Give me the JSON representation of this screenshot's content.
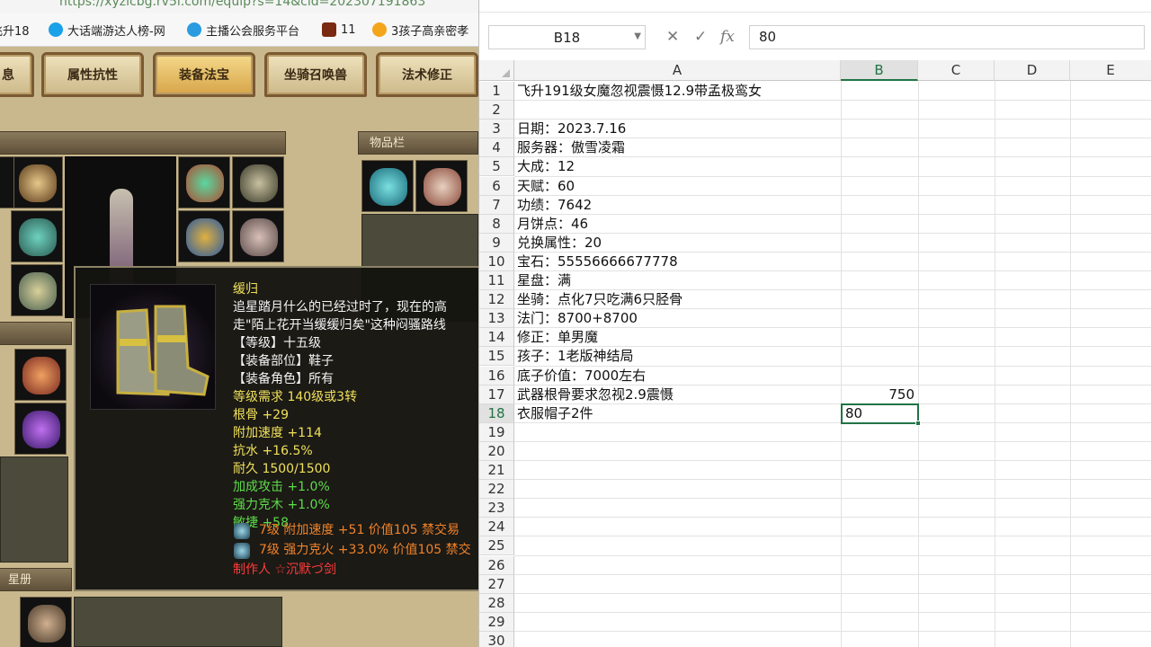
{
  "browser": {
    "url_fragment": "https://xyzlcbg.rv5i.com/equip?s=14&cid=202307191863",
    "bookmarks": [
      {
        "label": "飞升18",
        "color": "#2e6fd9"
      },
      {
        "label": "大话端游达人榜-网",
        "color": "#1aa1e8"
      },
      {
        "label": "主播公会服务平台",
        "color": "#2a9be0"
      },
      {
        "label": "11",
        "color": "#7a2a10"
      },
      {
        "label": "3孩子高亲密孝",
        "color": "#f3a51c"
      }
    ]
  },
  "game": {
    "tabs": [
      "息",
      "属性抗性",
      "装备法宝",
      "坐骑召唤兽",
      "法术修正"
    ],
    "active_tab": "装备法宝",
    "inventory_title": "物品栏",
    "starbook_title": "星册",
    "tooltip": {
      "name": "缓归",
      "desc1": "追星踏月什么的已经过时了，现在的高",
      "desc2": "走\"陌上花开当缓缓归矣\"这种闷骚路线",
      "level": "【等级】十五级",
      "slot": "【装备部位】鞋子",
      "role": "【装备角色】所有",
      "req": "等级需求 140级或3转",
      "stat1": "根骨 +29",
      "stat2": "附加速度 +114",
      "stat3": "抗水 +16.5%",
      "durability": "耐久 1500/1500",
      "bonus1": "加成攻击 +1.0%",
      "bonus2": "强力克木 +1.0%",
      "bonus3": "敏捷 +58",
      "gem1": "7级 附加速度 +51 价值105 禁交易",
      "gem2": "7级 强力克火 +33.0% 价值105 禁交",
      "maker": "制作人 ☆沉默づ剑"
    }
  },
  "sheet": {
    "name_box": "B18",
    "formula_value": "80",
    "columns": [
      "A",
      "B",
      "C",
      "D",
      "E"
    ],
    "rows": [
      {
        "n": "1",
        "a": "飞升191级女魔忽视震慑12.9带孟极鸾女",
        "b": ""
      },
      {
        "n": "2",
        "a": "",
        "b": ""
      },
      {
        "n": "3",
        "a": "日期：2023.7.16",
        "b": ""
      },
      {
        "n": "4",
        "a": "服务器：傲雪凌霜",
        "b": ""
      },
      {
        "n": "5",
        "a": "大成：12",
        "b": ""
      },
      {
        "n": "6",
        "a": "天赋：60",
        "b": ""
      },
      {
        "n": "7",
        "a": "功绩：7642",
        "b": ""
      },
      {
        "n": "8",
        "a": "月饼点：46",
        "b": ""
      },
      {
        "n": "9",
        "a": "兑换属性：20",
        "b": ""
      },
      {
        "n": "10",
        "a": "宝石：55556666677778",
        "b": ""
      },
      {
        "n": "11",
        "a": "星盘：满",
        "b": ""
      },
      {
        "n": "12",
        "a": "坐骑：点化7只吃满6只胫骨",
        "b": ""
      },
      {
        "n": "13",
        "a": "法门：8700+8700",
        "b": ""
      },
      {
        "n": "14",
        "a": "修正：单男魔",
        "b": ""
      },
      {
        "n": "15",
        "a": "孩子：1老版神结局",
        "b": ""
      },
      {
        "n": "16",
        "a": "底子价值：7000左右",
        "b": ""
      },
      {
        "n": "17",
        "a": "武器根骨要求忽视2.9震慑",
        "b": "750"
      },
      {
        "n": "18",
        "a": "衣服帽子2件",
        "b": "80"
      },
      {
        "n": "19",
        "a": "",
        "b": ""
      },
      {
        "n": "20",
        "a": "",
        "b": ""
      },
      {
        "n": "21",
        "a": "",
        "b": ""
      },
      {
        "n": "22",
        "a": "",
        "b": ""
      },
      {
        "n": "23",
        "a": "",
        "b": ""
      },
      {
        "n": "24",
        "a": "",
        "b": ""
      },
      {
        "n": "25",
        "a": "",
        "b": ""
      },
      {
        "n": "26",
        "a": "",
        "b": ""
      },
      {
        "n": "27",
        "a": "",
        "b": ""
      },
      {
        "n": "28",
        "a": "",
        "b": ""
      },
      {
        "n": "29",
        "a": "",
        "b": ""
      },
      {
        "n": "30",
        "a": "",
        "b": ""
      }
    ],
    "selected_row": "18",
    "accent": "#217346"
  }
}
